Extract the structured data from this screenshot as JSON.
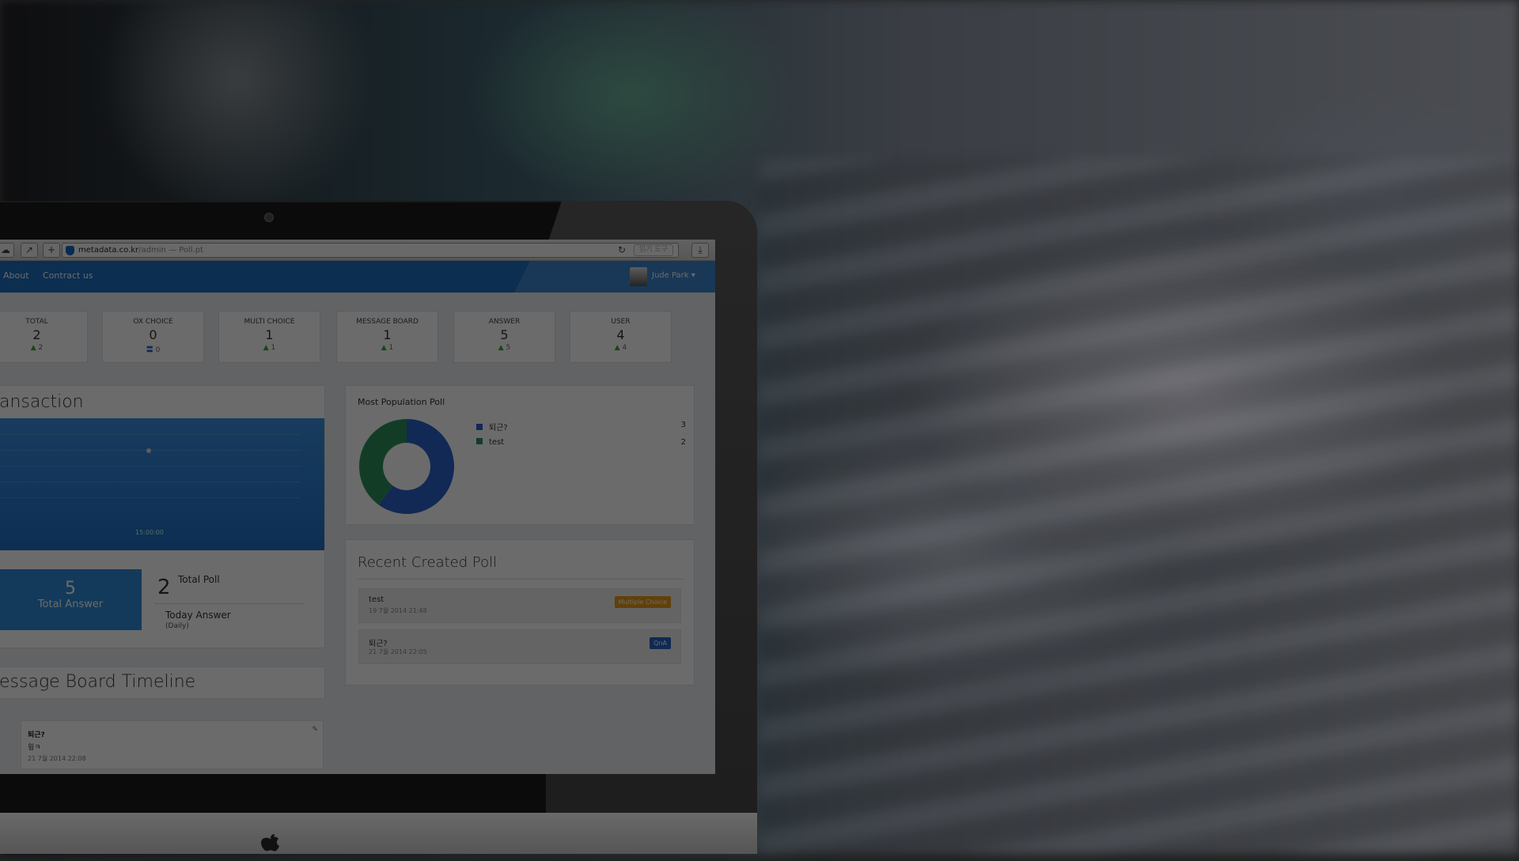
{
  "browser": {
    "url_host": "metadata.co.kr",
    "url_path": "/admin — Poll.pt",
    "reader_label": "읽기 도구"
  },
  "nav": {
    "links": [
      "About",
      "Contract us"
    ],
    "user": "Jude Park ▾"
  },
  "stats": [
    {
      "title": "TOTAL",
      "value": "2",
      "delta": "2",
      "trend": "up"
    },
    {
      "title": "OX CHOICE",
      "value": "0",
      "delta": "0",
      "trend": "flat"
    },
    {
      "title": "MULTI CHOICE",
      "value": "1",
      "delta": "1",
      "trend": "up"
    },
    {
      "title": "MESSAGE BOARD",
      "value": "1",
      "delta": "1",
      "trend": "up"
    },
    {
      "title": "ANSWER",
      "value": "5",
      "delta": "5",
      "trend": "up"
    },
    {
      "title": "USER",
      "value": "4",
      "delta": "4",
      "trend": "up"
    }
  ],
  "transaction": {
    "title": "ansaction",
    "x_tick": "15:00:00"
  },
  "summary": {
    "total_answer_value": "5",
    "total_answer_label": "Total Answer",
    "total_poll_value": "2",
    "total_poll_label": "Total Poll",
    "today_label": "Today Answer",
    "today_sub": "(Daily)"
  },
  "timeline": {
    "title": "essage Board Timeline",
    "item": {
      "title": "퇴근?",
      "body": "윙ㅋ",
      "date": "21 7월 2014 22:08"
    }
  },
  "popular": {
    "title": "Most Population Poll"
  },
  "chart_data": {
    "type": "pie",
    "title": "Most Population Poll",
    "categories": [
      "퇴근?",
      "test"
    ],
    "values": [
      3,
      2
    ],
    "colors": [
      "#2a62c8",
      "#2e8f5e"
    ]
  },
  "recent": {
    "title": "Recent Created Poll",
    "items": [
      {
        "name": "test",
        "date": "19 7월 2014 21:48",
        "badge": "Multiple Choice",
        "badge_color": "#e69a1a"
      },
      {
        "name": "퇴근?",
        "date": "21 7월 2014 22:05",
        "badge": "QnA",
        "badge_color": "#2a62c8"
      }
    ]
  }
}
